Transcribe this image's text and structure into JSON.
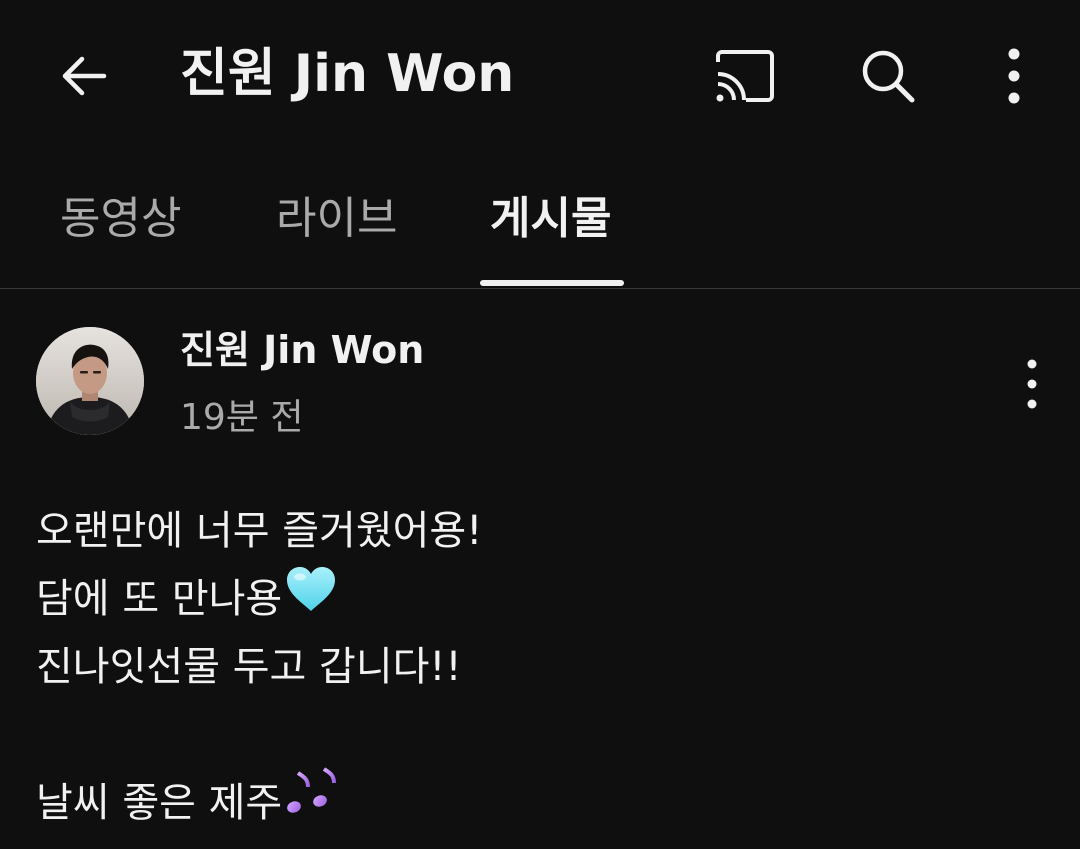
{
  "header": {
    "title": "진원 Jin Won",
    "icons": [
      "arrow-left-icon",
      "cast-icon",
      "search-icon",
      "more-vertical-icon"
    ]
  },
  "tabs": [
    {
      "label": "동영상",
      "active": false
    },
    {
      "label": "라이브",
      "active": false
    },
    {
      "label": "게시물",
      "active": true
    }
  ],
  "post": {
    "author": "진원 Jin Won",
    "time": "19분 전",
    "lines": [
      {
        "text": "오랜만에 너무 즐거웠어용!"
      },
      {
        "text": "담에 또 만나용",
        "emoji": "light-blue-heart-icon"
      },
      {
        "text": "진나잇선물 두고 갑니다!!"
      },
      {
        "text": ""
      },
      {
        "text": "날씨 좋은 제주",
        "emoji": "musical-notes-icon"
      }
    ]
  },
  "colors": {
    "background": "#0f0f0f",
    "text_primary": "#f1f1f1",
    "text_secondary": "#aaaaaa",
    "divider": "#3a3a3a",
    "heart": "#7fe3f2",
    "notes": "#b57be6"
  }
}
